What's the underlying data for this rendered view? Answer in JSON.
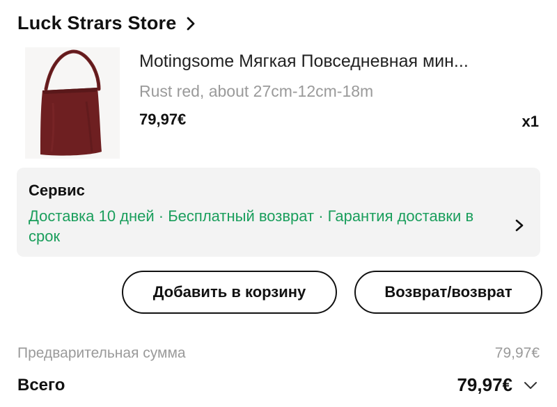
{
  "store": {
    "name": "Luck Strars Store",
    "chevron_icon": "chevron-right-icon"
  },
  "product": {
    "image_icon": "bag-image",
    "image_color": "#6e1f21",
    "title": "Motingsome Мягкая Повседневная мин...",
    "variant": "Rust red, about 27cm-12cm-18m",
    "price": "79,97€",
    "quantity": "x1"
  },
  "service": {
    "title": "Сервис",
    "description": "Доставка 10 дней · Бесплатный возврат · Гарантия доставки в срок",
    "description_color": "#1a9e5c",
    "chevron_icon": "chevron-right-icon"
  },
  "buttons": {
    "add_to_cart": "Добавить в корзину",
    "return": "Возврат/возврат"
  },
  "summary": {
    "subtotal_label": "Предварительная сумма",
    "subtotal_value": "79,97€",
    "total_label": "Всего",
    "total_value": "79,97€",
    "expand_icon": "chevron-down-icon"
  }
}
